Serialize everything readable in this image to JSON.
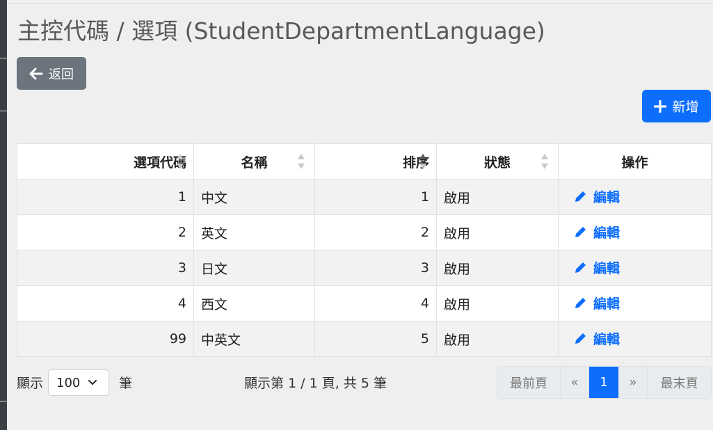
{
  "page": {
    "title": "主控代碼 / 選項 (StudentDepartmentLanguage)"
  },
  "toolbar": {
    "back_label": "返回",
    "add_label": "新增"
  },
  "table": {
    "headers": {
      "code": "選項代碼",
      "name": "名稱",
      "order": "排序",
      "status": "狀態",
      "action": "操作"
    },
    "rows": [
      {
        "code": "1",
        "name": "中文",
        "order": "1",
        "status": "啟用",
        "action": "編輯"
      },
      {
        "code": "2",
        "name": "英文",
        "order": "2",
        "status": "啟用",
        "action": "編輯"
      },
      {
        "code": "3",
        "name": "日文",
        "order": "3",
        "status": "啟用",
        "action": "編輯"
      },
      {
        "code": "4",
        "name": "西文",
        "order": "4",
        "status": "啟用",
        "action": "編輯"
      },
      {
        "code": "99",
        "name": "中英文",
        "order": "5",
        "status": "啟用",
        "action": "編輯"
      }
    ]
  },
  "footer": {
    "show_label": "顯示",
    "page_size": "100",
    "unit_label": "筆",
    "page_info": "顯示第 1 / 1 頁, 共 5 筆"
  },
  "pagination": {
    "first": "最前頁",
    "prev": "«",
    "current": "1",
    "next": "»",
    "last": "最末頁"
  },
  "colors": {
    "primary": "#0d6efd",
    "secondary": "#6c757d",
    "background": "#efefef"
  },
  "icons": {
    "back": "arrow-left-icon",
    "add": "plus-icon",
    "edit": "pencil-icon",
    "sort": "sort-icon",
    "dropdown": "chevron-down-icon"
  }
}
